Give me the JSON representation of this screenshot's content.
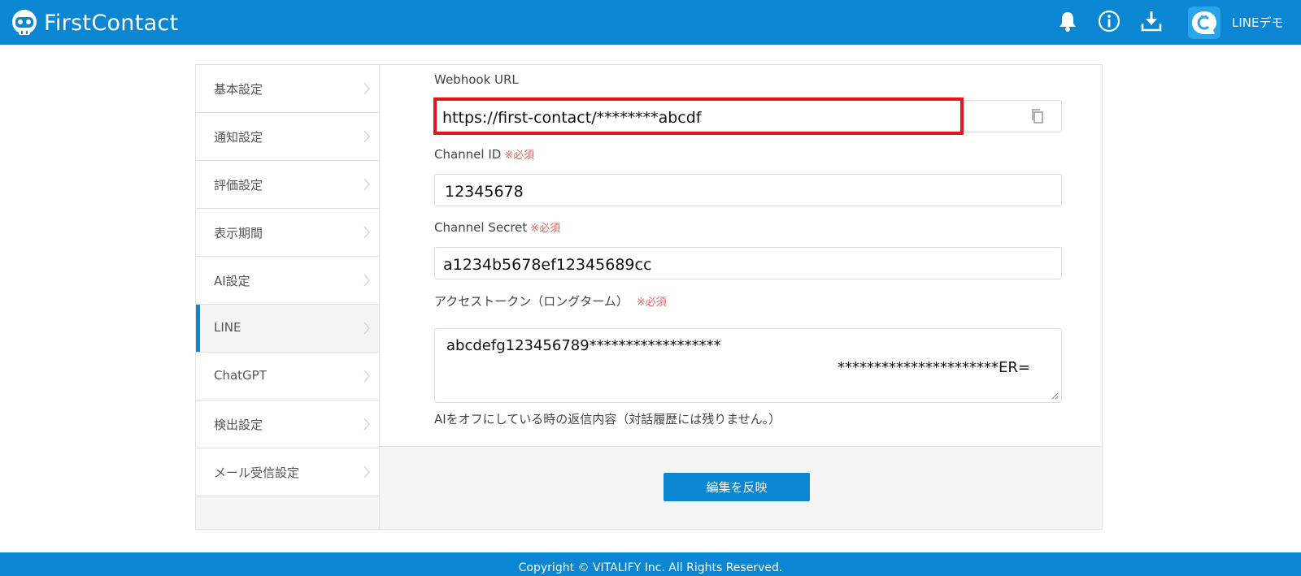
{
  "header": {
    "logo_text": "FirstContact",
    "user_name": "LINEデモ",
    "icons": [
      "bell-icon",
      "info-icon",
      "download-icon",
      "avatar-icon"
    ]
  },
  "sidebar": {
    "items": [
      {
        "label": "基本設定"
      },
      {
        "label": "通知設定"
      },
      {
        "label": "評価設定"
      },
      {
        "label": "表示期間"
      },
      {
        "label": "AI設定"
      },
      {
        "label": "LINE",
        "active": true
      },
      {
        "label": "ChatGPT"
      },
      {
        "label": "検出設定"
      },
      {
        "label": "メール受信設定"
      }
    ]
  },
  "form": {
    "webhook": {
      "label": "Webhook URL",
      "value": "https://first-contact/********abcdf"
    },
    "channel_id": {
      "label": "Channel ID",
      "required": "※必須",
      "value": "12345678"
    },
    "channel_secret": {
      "label": "Channel Secret",
      "required": "※必須",
      "value": "a1234b5678ef12345689cc"
    },
    "access_token": {
      "label": "アクセストークン（ロングターム）",
      "required": "※必須",
      "line1": "abcdefg123456789******************",
      "line2": "**********************ER="
    },
    "ai_off_label": "AIをオフにしている時の返信内容（対話履歴には残りません。）"
  },
  "actions": {
    "apply_label": "編集を反映"
  },
  "footer": {
    "copyright": "Copyright © VITALIFY Inc. All Rights Reserved."
  },
  "colors": {
    "brand": "#0a86d2",
    "highlight": "#e3151a",
    "required": "#e7605c"
  }
}
